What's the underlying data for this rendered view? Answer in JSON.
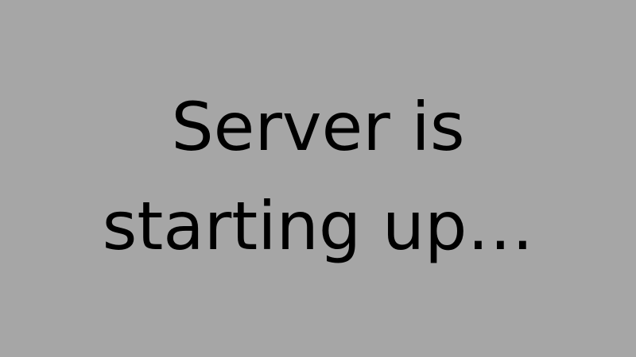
{
  "screen": {
    "background_color": "#a6a6a6",
    "text_color": "#000000",
    "message_lines": [
      "Server is",
      "starting up…"
    ]
  }
}
